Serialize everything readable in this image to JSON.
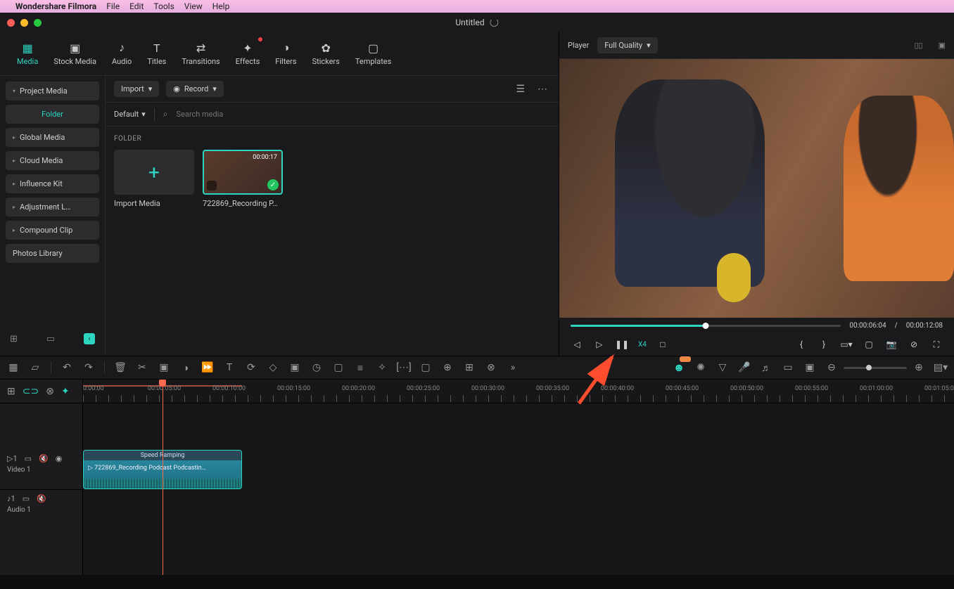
{
  "menubar": {
    "app": "Wondershare Filmora",
    "items": [
      "File",
      "Edit",
      "Tools",
      "View",
      "Help"
    ]
  },
  "window": {
    "title": "Untitled"
  },
  "maintabs": [
    {
      "label": "Media",
      "active": true
    },
    {
      "label": "Stock Media"
    },
    {
      "label": "Audio"
    },
    {
      "label": "Titles"
    },
    {
      "label": "Transitions"
    },
    {
      "label": "Effects",
      "badged": true
    },
    {
      "label": "Filters"
    },
    {
      "label": "Stickers"
    },
    {
      "label": "Templates"
    }
  ],
  "sidebar": {
    "items": [
      {
        "label": "Project Media",
        "expand": true
      },
      {
        "label": "Folder",
        "child": true
      },
      {
        "label": "Global Media",
        "expand": true
      },
      {
        "label": "Cloud Media",
        "expand": true
      },
      {
        "label": "Influence Kit",
        "expand": true
      },
      {
        "label": "Adjustment L…",
        "expand": true
      },
      {
        "label": "Compound Clip",
        "expand": true
      },
      {
        "label": "Photos Library"
      }
    ]
  },
  "browser": {
    "import": "Import",
    "record": "Record",
    "sort": "Default",
    "search_placeholder": "Search media",
    "section": "FOLDER",
    "import_tile": "Import Media",
    "clip": {
      "duration": "00:00:17",
      "name": "722869_Recording P…"
    }
  },
  "player": {
    "label": "Player",
    "quality": "Full Quality",
    "current": "00:00:06:04",
    "sep": "/",
    "total": "00:00:12:08",
    "speed": "X4",
    "progress_pct": 50
  },
  "timeline": {
    "ticks": [
      "0:00:00",
      "00:00:05:00",
      "00:00:10:00",
      "00:00:15:00",
      "00:00:20:00",
      "00:00:25:00",
      "00:00:30:00",
      "00:00:35:00",
      "00:00:40:00",
      "00:00:45:00",
      "00:00:50:00",
      "00:00:55:00",
      "00:01:00:00",
      "00:01:05:00"
    ],
    "video_label": "Video 1",
    "audio_label": "Audio 1",
    "clip": {
      "ramp": "Speed Ramping",
      "name": "722869_Recording Podcast Podcastin…"
    }
  }
}
